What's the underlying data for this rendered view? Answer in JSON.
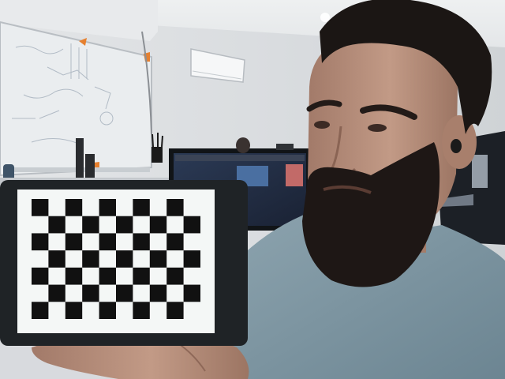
{
  "scene": {
    "colors": {
      "wall": "#dde0e3",
      "ceiling": "#e6e8ea",
      "whiteboard": "#e9ecee",
      "shirt": "#7f97a3",
      "skin": "#b88f7c",
      "hair": "#1b1614",
      "tablet_bezel": "#1f2326",
      "board_light": "#f4f7f6",
      "board_dark": "#111111"
    }
  },
  "checkerboard": {
    "rows": 7,
    "cols": 10
  }
}
